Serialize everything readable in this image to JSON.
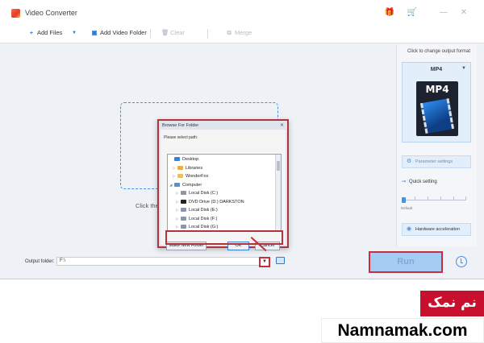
{
  "window": {
    "title": "Video Converter",
    "controls": {
      "gift": "🎁",
      "cart": "🛒",
      "minimize": "—",
      "close": "✕"
    }
  },
  "toolbar": {
    "add_files": "Add Files",
    "add_files_dropdown": "▼",
    "add_video_folder": "Add Video Folder",
    "clear": "Clear",
    "merge": "Merge"
  },
  "main": {
    "drop_hint": "Click the"
  },
  "output_panel": {
    "title": "Click to change output format",
    "format": "MP4",
    "format_caret": "▼",
    "format_art_label": "MP4",
    "parameter_settings": "Parameter settings",
    "quick_setting": "Quick setting",
    "slider_label": "Default",
    "hardware_acceleration": "Hardware acceleration"
  },
  "bottom": {
    "output_folder_label": "Output folder:",
    "output_folder_value": "F:\\",
    "dropdown": "▼",
    "run": "Run"
  },
  "dialog": {
    "title": "Browse For Folder",
    "close": "✕",
    "prompt": "Please select path:",
    "tree": [
      {
        "label": "Desktop",
        "expand": "",
        "icon": "desktop-icon",
        "color": "#3c7fd6"
      },
      {
        "label": "Libraries",
        "expand": "▷",
        "icon": "library-icon",
        "color": "#e8b04a"
      },
      {
        "label": "WonderFox",
        "expand": "▷",
        "icon": "folder-icon",
        "color": "#e8c15a"
      },
      {
        "label": "Computer",
        "expand": "◢",
        "icon": "computer-icon",
        "color": "#5b8fd0"
      },
      {
        "label": "Local Disk (C:)",
        "expand": "▷",
        "icon": "drive-icon",
        "color": "#8a97a8"
      },
      {
        "label": "DVD Drive (D:) DARKSTON",
        "expand": "▷",
        "icon": "dvd-icon",
        "color": "#222222"
      },
      {
        "label": "Local Disk (E:)",
        "expand": "▷",
        "icon": "drive-icon",
        "color": "#8a97a8"
      },
      {
        "label": "Local Disk (F:)",
        "expand": "▷",
        "icon": "drive-icon",
        "color": "#8a97a8"
      },
      {
        "label": "Local Disk (G:)",
        "expand": "▷",
        "icon": "drive-icon",
        "color": "#8a97a8"
      }
    ],
    "make_new_folder": "Make New Folder",
    "ok": "OK",
    "cancel": "Cancel"
  },
  "watermark": {
    "persian": "نم نمک",
    "site": "Namnamak.com"
  },
  "colors": {
    "accent": "#4a90e2",
    "highlight_red": "#c5303c",
    "watermark_red": "#c8102e"
  }
}
